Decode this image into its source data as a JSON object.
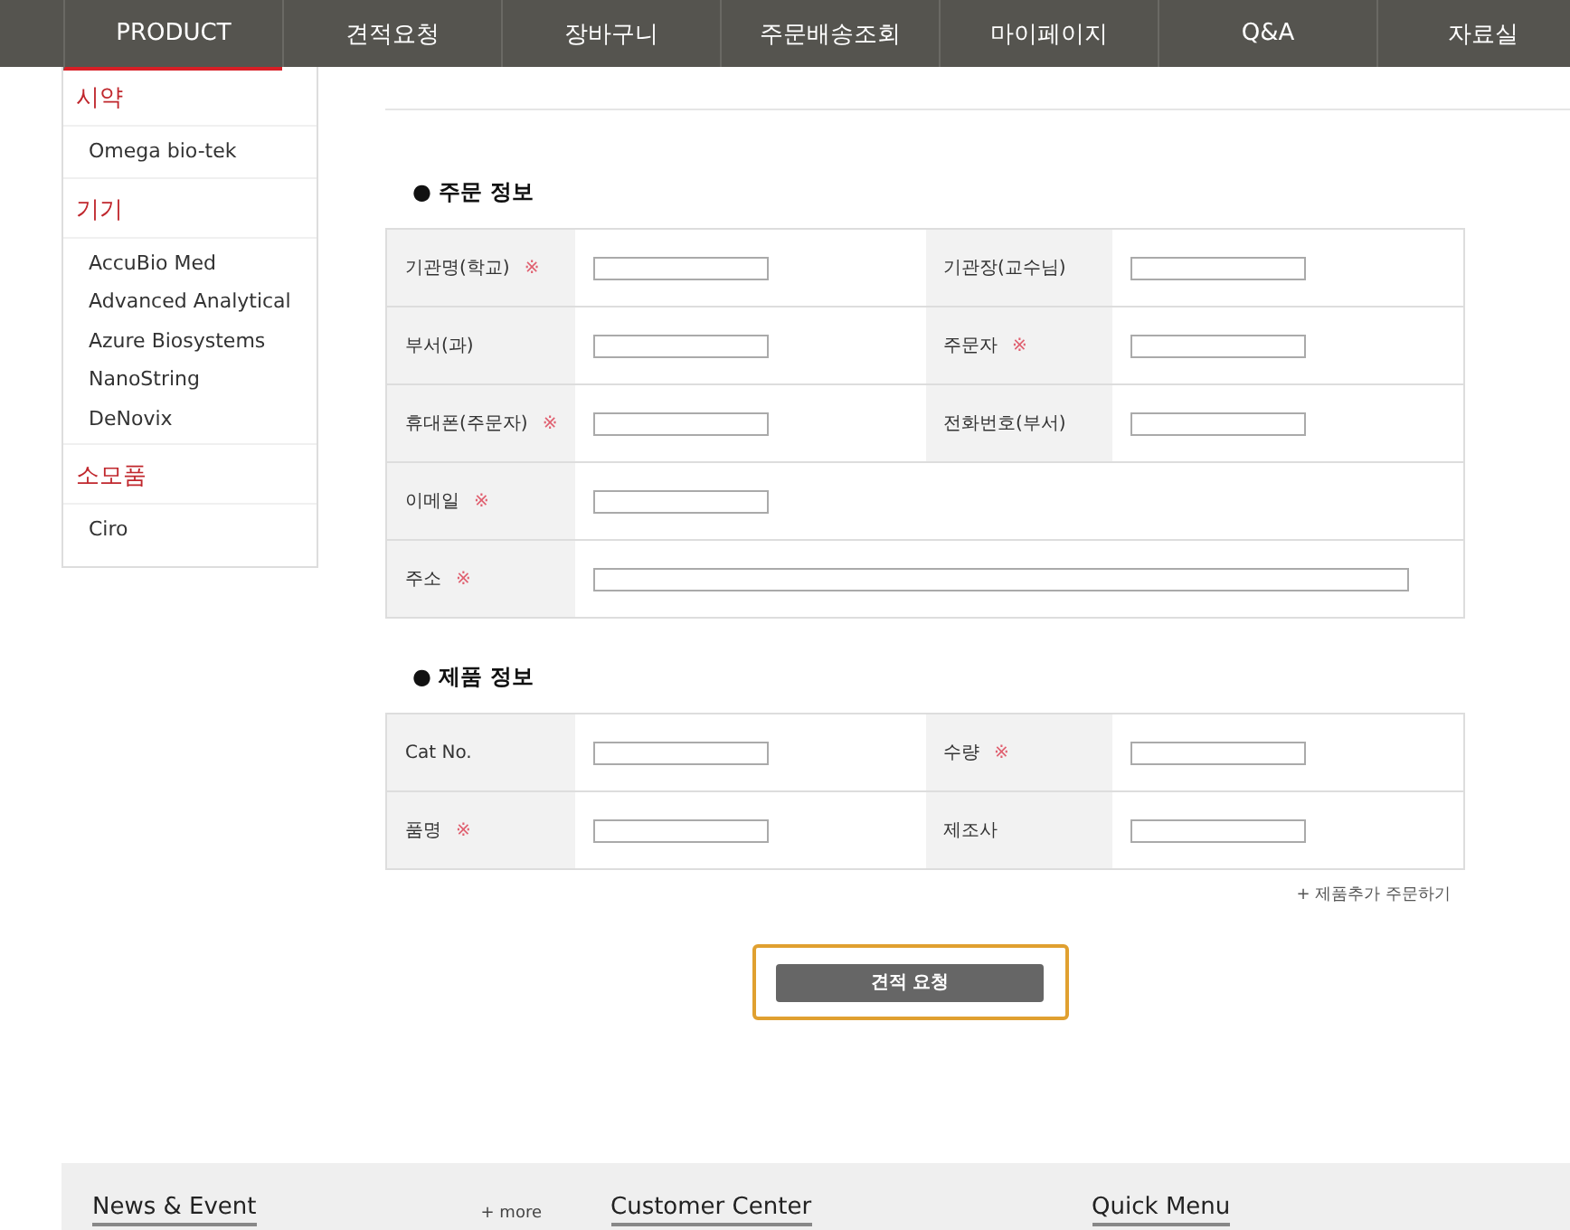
{
  "nav": [
    {
      "label": "PRODUCT",
      "selected": true
    },
    {
      "label": "견적요청",
      "selected": false
    },
    {
      "label": "장바구니",
      "selected": false
    },
    {
      "label": "주문배송조회",
      "selected": false
    },
    {
      "label": "마이페이지",
      "selected": false
    },
    {
      "label": "Q&A",
      "selected": false
    },
    {
      "label": "자료실",
      "selected": false
    }
  ],
  "sidebar": [
    {
      "title": "시약",
      "items": [
        "Omega bio-tek"
      ]
    },
    {
      "title": "기기",
      "items": [
        "AccuBio Med",
        "Advanced Analytical",
        "Azure Biosystems",
        "NanoString",
        "DeNovix"
      ]
    },
    {
      "title": "소모품",
      "items": [
        "Ciro"
      ]
    }
  ],
  "required_mark": "※",
  "sections": [
    {
      "title": "● 주문 정보",
      "rows": [
        [
          {
            "label": "기관명(학교)",
            "required": true
          },
          {
            "label": "기관장(교수님)",
            "required": false
          }
        ],
        [
          {
            "label": "부서(과)",
            "required": false
          },
          {
            "label": "주문자",
            "required": true
          }
        ],
        [
          {
            "label": "휴대폰(주문자)",
            "required": true
          },
          {
            "label": "전화번호(부서)",
            "required": false
          }
        ],
        [
          {
            "label": "이메일",
            "required": true
          }
        ],
        [
          {
            "label": "주소",
            "required": true,
            "kind": "wide"
          }
        ]
      ]
    },
    {
      "title": "● 제품 정보",
      "rows": [
        [
          {
            "label": "Cat No.",
            "required": false
          },
          {
            "label": "수량",
            "required": true
          }
        ],
        [
          {
            "label": "품명",
            "required": true
          },
          {
            "label": "제조사",
            "required": false
          }
        ]
      ]
    }
  ],
  "add_product_link": "+ 제품추가 주문하기",
  "submit_button": {
    "label": "견적 요청",
    "focused": true
  },
  "footer": {
    "news": "News & Event",
    "more": "+ more",
    "customer": "Customer Center",
    "quick": "Quick Menu"
  }
}
